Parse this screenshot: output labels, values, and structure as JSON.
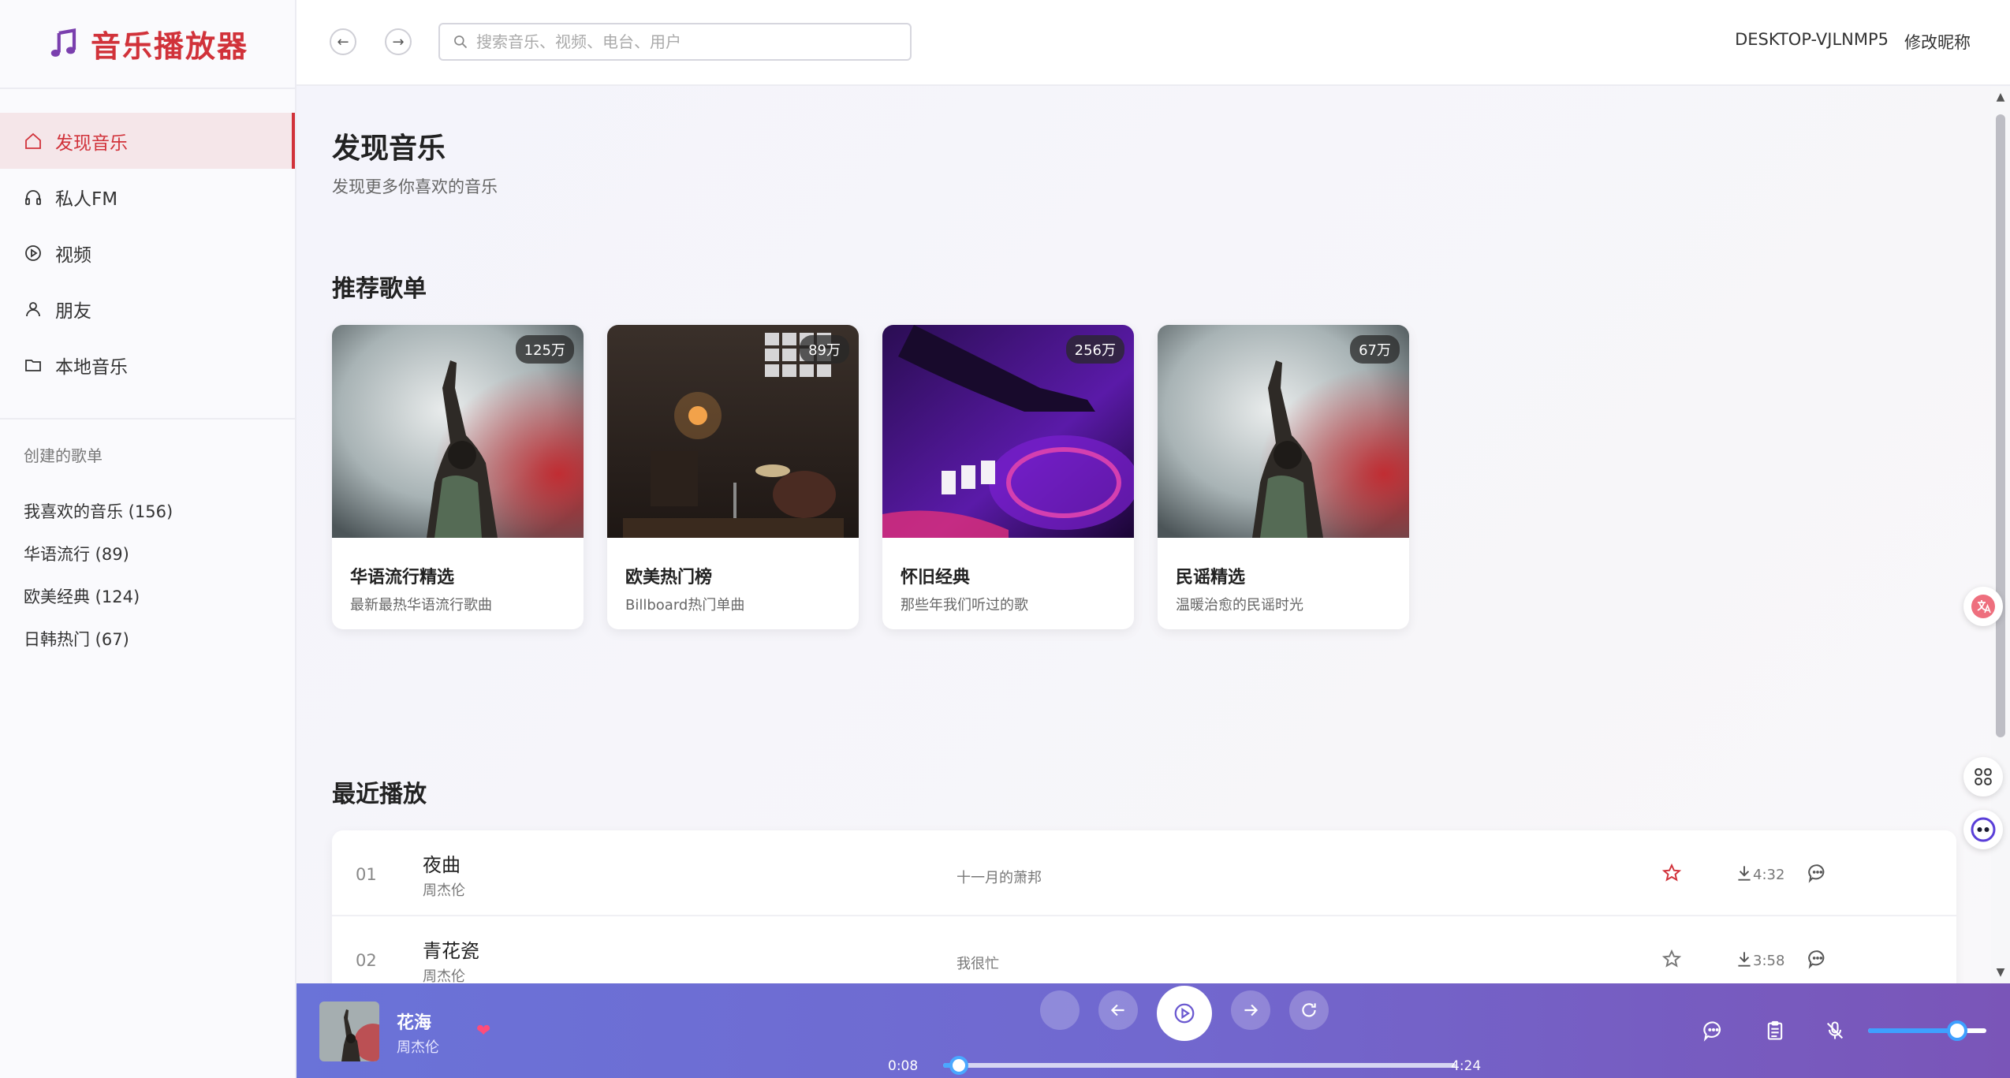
{
  "app": {
    "title": "音乐播放器",
    "accent": "#d1323a"
  },
  "sidebar": {
    "items": [
      {
        "label": "发现音乐",
        "icon": "home-icon",
        "active": true
      },
      {
        "label": "私人FM",
        "icon": "headphones-icon",
        "active": false
      },
      {
        "label": "视频",
        "icon": "play-circle-icon",
        "active": false
      },
      {
        "label": "朋友",
        "icon": "user-icon",
        "active": false
      },
      {
        "label": "本地音乐",
        "icon": "folder-icon",
        "active": false
      }
    ],
    "playlists_title": "创建的歌单",
    "playlists": [
      {
        "label": "我喜欢的音乐 (156)"
      },
      {
        "label": "华语流行 (89)"
      },
      {
        "label": "欧美经典 (124)"
      },
      {
        "label": "日韩热门 (67)"
      }
    ]
  },
  "header": {
    "search_placeholder": "搜索音乐、视频、电台、用户",
    "username": "DESKTOP-VJLNMP5",
    "edit_nickname": "修改昵称"
  },
  "main": {
    "title": "发现音乐",
    "subtitle": "发现更多你喜欢的音乐",
    "recommend_title": "推荐歌单",
    "playlists": [
      {
        "name": "华语流行精选",
        "desc": "最新最热华语流行歌曲",
        "count": "125万",
        "theme": "concert"
      },
      {
        "name": "欧美热门榜",
        "desc": "Billboard热门单曲",
        "count": "89万",
        "theme": "studio"
      },
      {
        "name": "怀旧经典",
        "desc": "那些年我们听过的歌",
        "count": "256万",
        "theme": "dj"
      },
      {
        "name": "民谣精选",
        "desc": "温暖治愈的民谣时光",
        "count": "67万",
        "theme": "concert"
      }
    ],
    "recent_title": "最近播放",
    "recent": [
      {
        "index": "01",
        "title": "夜曲",
        "artist": "周杰伦",
        "album": "十一月的萧邦",
        "duration": "4:32",
        "favorited": true
      },
      {
        "index": "02",
        "title": "青花瓷",
        "artist": "周杰伦",
        "album": "我很忙",
        "duration": "3:58",
        "favorited": false
      }
    ]
  },
  "player": {
    "song": "花海",
    "artist": "周杰伦",
    "current_time": "0:08",
    "total_time": "4:24",
    "progress": 0.031,
    "volume": 0.75
  }
}
